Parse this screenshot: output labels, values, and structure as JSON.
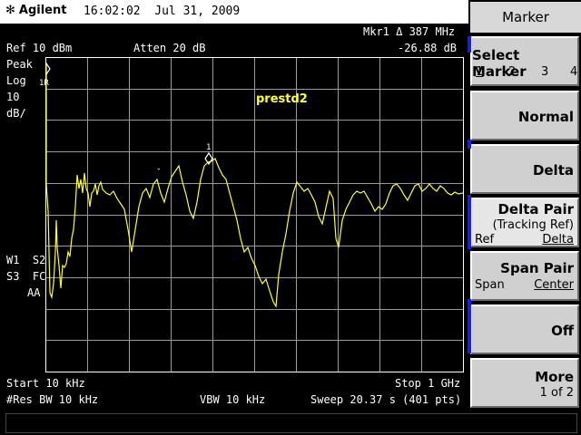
{
  "header": {
    "brand": "Agilent",
    "time": "16:02:02",
    "date": "Jul 31, 2009"
  },
  "readout": {
    "marker": "Mkr1 Δ 387 MHz",
    "marker_value": "-26.88 dB",
    "ref_level": "Ref 10 dBm",
    "atten": "Atten 20 dB",
    "detector": "Peak",
    "scale_type": "Log",
    "scale_value": "10",
    "scale_unit": "dB/",
    "w1s2": "W1  S2",
    "s3fc": "S3  FC",
    "aa": "AA",
    "start": "Start 10 kHz",
    "stop": "Stop 1 GHz",
    "res_bw": "#Res BW 10 kHz",
    "vbw": "VBW 10 kHz",
    "sweep": "Sweep 20.37 s (401 pts)"
  },
  "trace": {
    "label": "prestd2",
    "color": "#ffff33",
    "marker_ref_label": "1R",
    "marker_delta_label": "1"
  },
  "softkeys": {
    "title": "Marker",
    "select_marker": "Select Marker",
    "marker_nums": [
      "1",
      "2",
      "3",
      "4"
    ],
    "normal": "Normal",
    "delta": "Delta",
    "delta_pair": "Delta Pair",
    "tracking_ref": "(Tracking Ref)",
    "ref": "Ref",
    "delta_sub": "Delta",
    "span_pair": "Span Pair",
    "span": "Span",
    "center": "Center",
    "off": "Off",
    "more": "More",
    "page": "1 of 2"
  }
}
